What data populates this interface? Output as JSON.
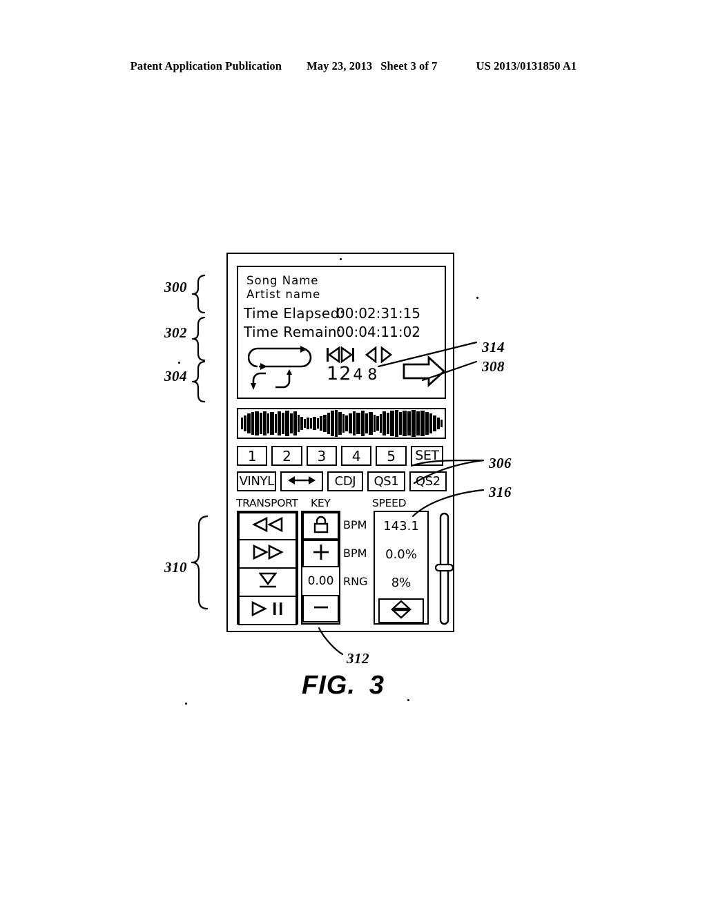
{
  "header": {
    "publication": "Patent Application Publication",
    "date": "May 23, 2013",
    "sheet": "Sheet 3 of 7",
    "patent_number": "US 2013/0131850 A1"
  },
  "figure": {
    "caption_prefix": "FIG.",
    "caption_number": "3"
  },
  "display": {
    "song_name": "Song Name",
    "artist_name": "Artist name",
    "time_elapsed_label": "Time Elapsed:",
    "time_elapsed_value": "00:02:31:15",
    "time_remain_label": "Time Remain:",
    "time_remain_value": "00:04:11:02",
    "beat_numbers": [
      "1",
      "2",
      "4",
      "8"
    ],
    "loop_icon": "loop-cycle-icon",
    "skip_prev_icon": "skip-previous-icon",
    "skip_next_icon": "skip-next-icon",
    "nudge_back_icon": "nudge-back-icon",
    "nudge_forward_icon": "nudge-forward-icon",
    "big_arrow_icon": "right-arrow-icon"
  },
  "waveform": {
    "name": "track-waveform"
  },
  "cue_buttons": [
    {
      "label": "1"
    },
    {
      "label": "2"
    },
    {
      "label": "3"
    },
    {
      "label": "4"
    },
    {
      "label": "5"
    },
    {
      "label": "SET"
    }
  ],
  "mode_buttons": [
    {
      "label": "VINYL",
      "icon": ""
    },
    {
      "label": "",
      "icon": "left-right-arrow-icon"
    },
    {
      "label": "CDJ",
      "icon": ""
    },
    {
      "label": "QS1",
      "icon": ""
    },
    {
      "label": "QS2",
      "icon": ""
    }
  ],
  "sections": {
    "transport_label": "TRANSPORT",
    "key_label": "KEY",
    "speed_label": "SPEED"
  },
  "transport_buttons": [
    {
      "icon": "rewind-icon"
    },
    {
      "icon": "fast-forward-icon"
    },
    {
      "icon": "cue-icon"
    },
    {
      "icon": "play-pause-icon"
    }
  ],
  "key_controls": {
    "lock_icon": "key-lock-icon",
    "plus_label": "+",
    "value": "0.00",
    "minus_label": "—"
  },
  "speed_panel": {
    "rows": [
      {
        "label": "BPM",
        "value": "143.1"
      },
      {
        "label": "BPM",
        "value": "0.0%"
      },
      {
        "label": "RNG",
        "value": "8%"
      }
    ],
    "stepper_icon": "up-down-arrow-icon"
  },
  "pitch_fader": {
    "name": "pitch-fader"
  },
  "reference_numerals": [
    {
      "id": "300",
      "label": "300"
    },
    {
      "id": "302",
      "label": "302"
    },
    {
      "id": "304",
      "label": "304"
    },
    {
      "id": "306",
      "label": "306"
    },
    {
      "id": "308",
      "label": "308"
    },
    {
      "id": "310",
      "label": "310"
    },
    {
      "id": "312",
      "label": "312"
    },
    {
      "id": "314",
      "label": "314"
    },
    {
      "id": "316",
      "label": "316"
    }
  ]
}
